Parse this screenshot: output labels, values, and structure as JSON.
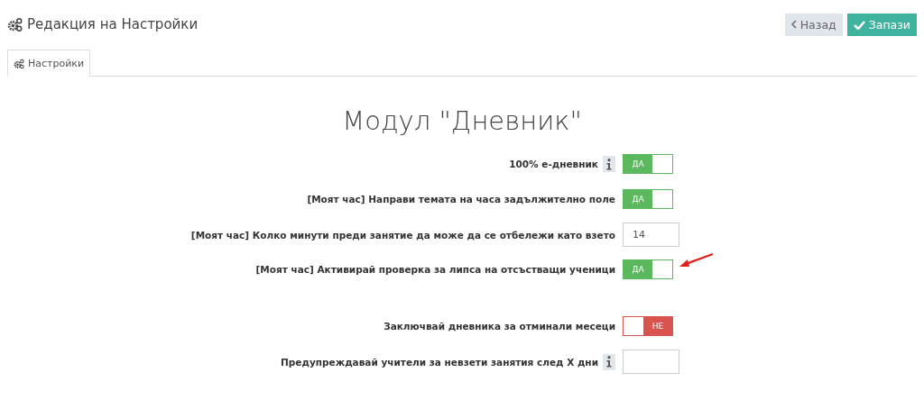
{
  "page": {
    "title": "Редакция на Настройки"
  },
  "buttons": [
    {
      "kind": "back",
      "label": "Назад"
    },
    {
      "kind": "save",
      "label": "Запази"
    }
  ],
  "tabs": [
    {
      "label": "Настройки",
      "selected": true
    }
  ],
  "heading": "Модул \"Дневник\"",
  "setting_groups": [
    [
      {
        "kind": "toggle",
        "label": "100% е-дневник",
        "info": true,
        "on": true,
        "state_text": "ДА",
        "annotated": false
      },
      {
        "kind": "toggle",
        "label": "[Моят час] Направи темата на часа задължително поле",
        "info": false,
        "on": true,
        "state_text": "ДА",
        "annotated": false
      },
      {
        "kind": "input",
        "label": "[Моят час] Колко минути преди занятие да може да се отбележи като взето",
        "info": false,
        "value": "14"
      },
      {
        "kind": "toggle",
        "label": "[Моят час] Активирай проверка за липса на отсъстващи ученици",
        "info": false,
        "on": true,
        "state_text": "ДА",
        "annotated": true
      }
    ],
    [
      {
        "kind": "toggle",
        "label": "Заключвай дневника за отминали месеци",
        "info": false,
        "on": false,
        "state_text": "НЕ",
        "annotated": false
      },
      {
        "kind": "input",
        "label": "Предупреждавай учители за невзети занятия след X дни",
        "info": true
      }
    ]
  ]
}
